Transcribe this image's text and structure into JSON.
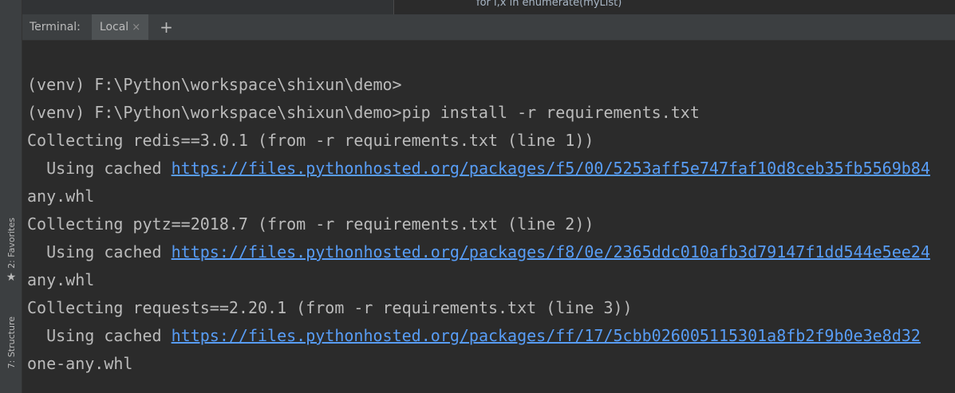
{
  "editor": {
    "snippet": "for i,x in enumerate(myList)"
  },
  "terminal": {
    "title": "Terminal:",
    "tabs": [
      {
        "label": "Local",
        "close_glyph": "×"
      }
    ],
    "new_tab_glyph": "+",
    "lines": [
      {
        "text": "(venv) F:\\Python\\workspace\\shixun\\demo>"
      },
      {
        "text": "(venv) F:\\Python\\workspace\\shixun\\demo>pip install -r requirements.txt"
      },
      {
        "text": "Collecting redis==3.0.1 (from -r requirements.txt (line 1))"
      },
      {
        "prefix": "  Using cached ",
        "link": "https://files.pythonhosted.org/packages/f5/00/5253aff5e747faf10d8ceb35fb5569b84"
      },
      {
        "text": "any.whl"
      },
      {
        "text": "Collecting pytz==2018.7 (from -r requirements.txt (line 2))"
      },
      {
        "prefix": "  Using cached ",
        "link": "https://files.pythonhosted.org/packages/f8/0e/2365ddc010afb3d79147f1dd544e5ee24"
      },
      {
        "text": "any.whl"
      },
      {
        "text": "Collecting requests==2.20.1 (from -r requirements.txt (line 3))"
      },
      {
        "prefix": "  Using cached ",
        "link": "https://files.pythonhosted.org/packages/ff/17/5cbb026005115301a8fb2f9b0e3e8d32"
      },
      {
        "text": "one-any.whl"
      }
    ]
  },
  "side_tools": {
    "favorites": {
      "label": "2: Favorites",
      "icon": "star-icon"
    },
    "structure": {
      "label": "7: Structure",
      "icon": "structure-icon"
    }
  },
  "colors": {
    "background": "#2b2b2b",
    "panel": "#3c3f41",
    "text": "#bbbbbb",
    "link": "#589df6"
  }
}
